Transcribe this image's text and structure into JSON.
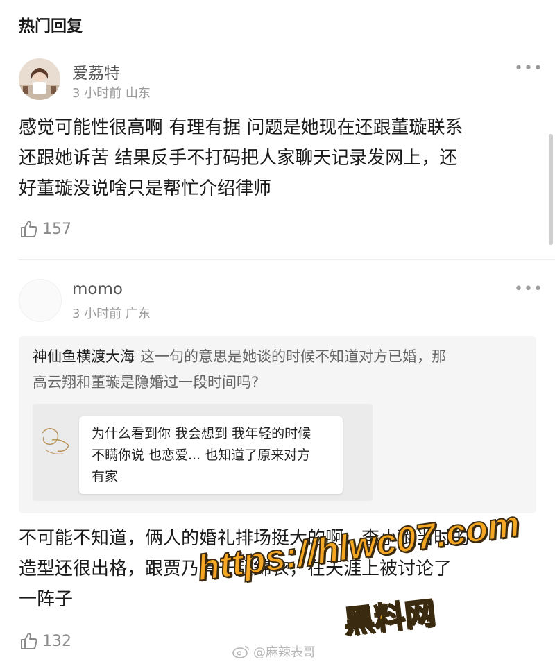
{
  "section_title": "热门回复",
  "comments": [
    {
      "username": "爱荔特",
      "time": "3 小时前",
      "location": "山东",
      "more_label": "•••",
      "lines": [
        "感觉可能性很高啊 有理有据 问题是她现在还跟董璇联系",
        "还跟她诉苦 结果反手不打码把人家聊天记录发网上，还",
        "好董璇没说啥只是帮忙介绍律师"
      ],
      "likes": "157"
    },
    {
      "username": "momo",
      "time": "3 小时前",
      "location": "广东",
      "more_label": "•••",
      "quote": {
        "author": "神仙鱼横渡大海",
        "line1": "这一句的意思是她谈的时候不知道对方已婚，那",
        "line2": "高云翔和董璇是隐婚过一段时间吗?",
        "screenshot_lines": [
          "为什么看到你 我会想到 我年轻的时候",
          "不瞒你说 也恋爱... 也知道了原来对方",
          "有家"
        ]
      },
      "lines": [
        "不可能不知道，俩人的婚礼排场挺大的啊，李小璐当时的",
        "造型还很出格，跟贾乃亮一起錦衣，在天涯上被讨论了",
        "一阵子"
      ],
      "likes": "132"
    }
  ],
  "watermark": {
    "url": "https://hlwc07.com",
    "name": "黑料网"
  },
  "credit": "@麻辣表哥"
}
